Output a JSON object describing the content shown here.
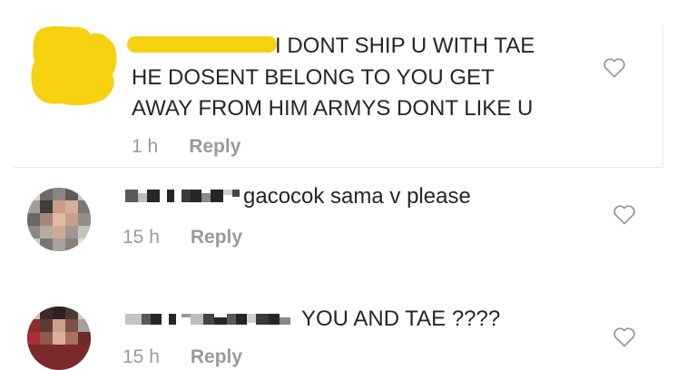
{
  "colors": {
    "highlight": "#f5d10f",
    "text": "#262626",
    "meta": "#999999",
    "heart": "#999999"
  },
  "comments": [
    {
      "lines": [
        "I DONT SHIP U WITH TAE",
        "HE DOSENT BELONG TO YOU GET",
        "AWAY FROM HIM ARMYS DONT LIKE U"
      ],
      "time": "1 h",
      "reply_label": "Reply",
      "icon": "heart-outline-icon"
    },
    {
      "lines": [
        "gacocok sama v please"
      ],
      "time": "15 h",
      "reply_label": "Reply",
      "icon": "heart-outline-icon"
    },
    {
      "lines": [
        "YOU AND TAE ????"
      ],
      "time": "15 h",
      "reply_label": "Reply",
      "icon": "heart-outline-icon"
    }
  ]
}
